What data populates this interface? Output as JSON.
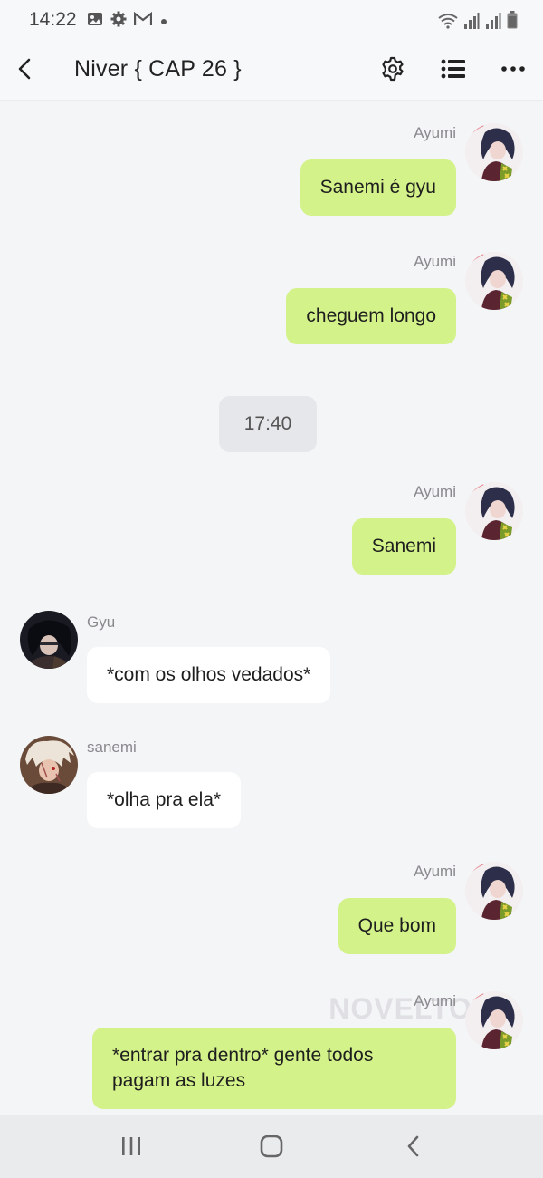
{
  "status_bar": {
    "time": "14:22",
    "left_icons": [
      "image-icon",
      "gear-icon",
      "gmail-icon",
      "dot-icon"
    ],
    "right_icons": [
      "wifi-icon",
      "signal-icon",
      "signal-icon",
      "battery-icon"
    ]
  },
  "header": {
    "title": "Niver { CAP 26 }",
    "icons": [
      "back-icon",
      "gear-icon",
      "list-icon",
      "more-icon"
    ]
  },
  "messages": [
    {
      "side": "right",
      "sender": "Ayumi",
      "text": "Sanemi é gyu"
    },
    {
      "side": "right",
      "sender": "Ayumi",
      "text": "cheguem longo"
    },
    {
      "type": "time",
      "text": "17:40"
    },
    {
      "side": "right",
      "sender": "Ayumi",
      "text": "Sanemi"
    },
    {
      "side": "left",
      "sender": "Gyu",
      "text": "*com os olhos vedados*"
    },
    {
      "side": "left",
      "sender": "sanemi",
      "text": "*olha pra ela*"
    },
    {
      "side": "right",
      "sender": "Ayumi",
      "text": "Que bom"
    },
    {
      "side": "right",
      "sender": "Ayumi",
      "text": "*entrar pra dentro* gente todos\npagam as luzes"
    }
  ],
  "watermark": "NOVELTO",
  "colors": {
    "outgoing_bubble": "#d4f28a",
    "incoming_bubble": "#ffffff",
    "background": "#f4f5f7",
    "time_pill": "#e6e7ea"
  },
  "nav_bar": {
    "icons": [
      "recent-apps-icon",
      "home-icon",
      "back-icon"
    ]
  }
}
